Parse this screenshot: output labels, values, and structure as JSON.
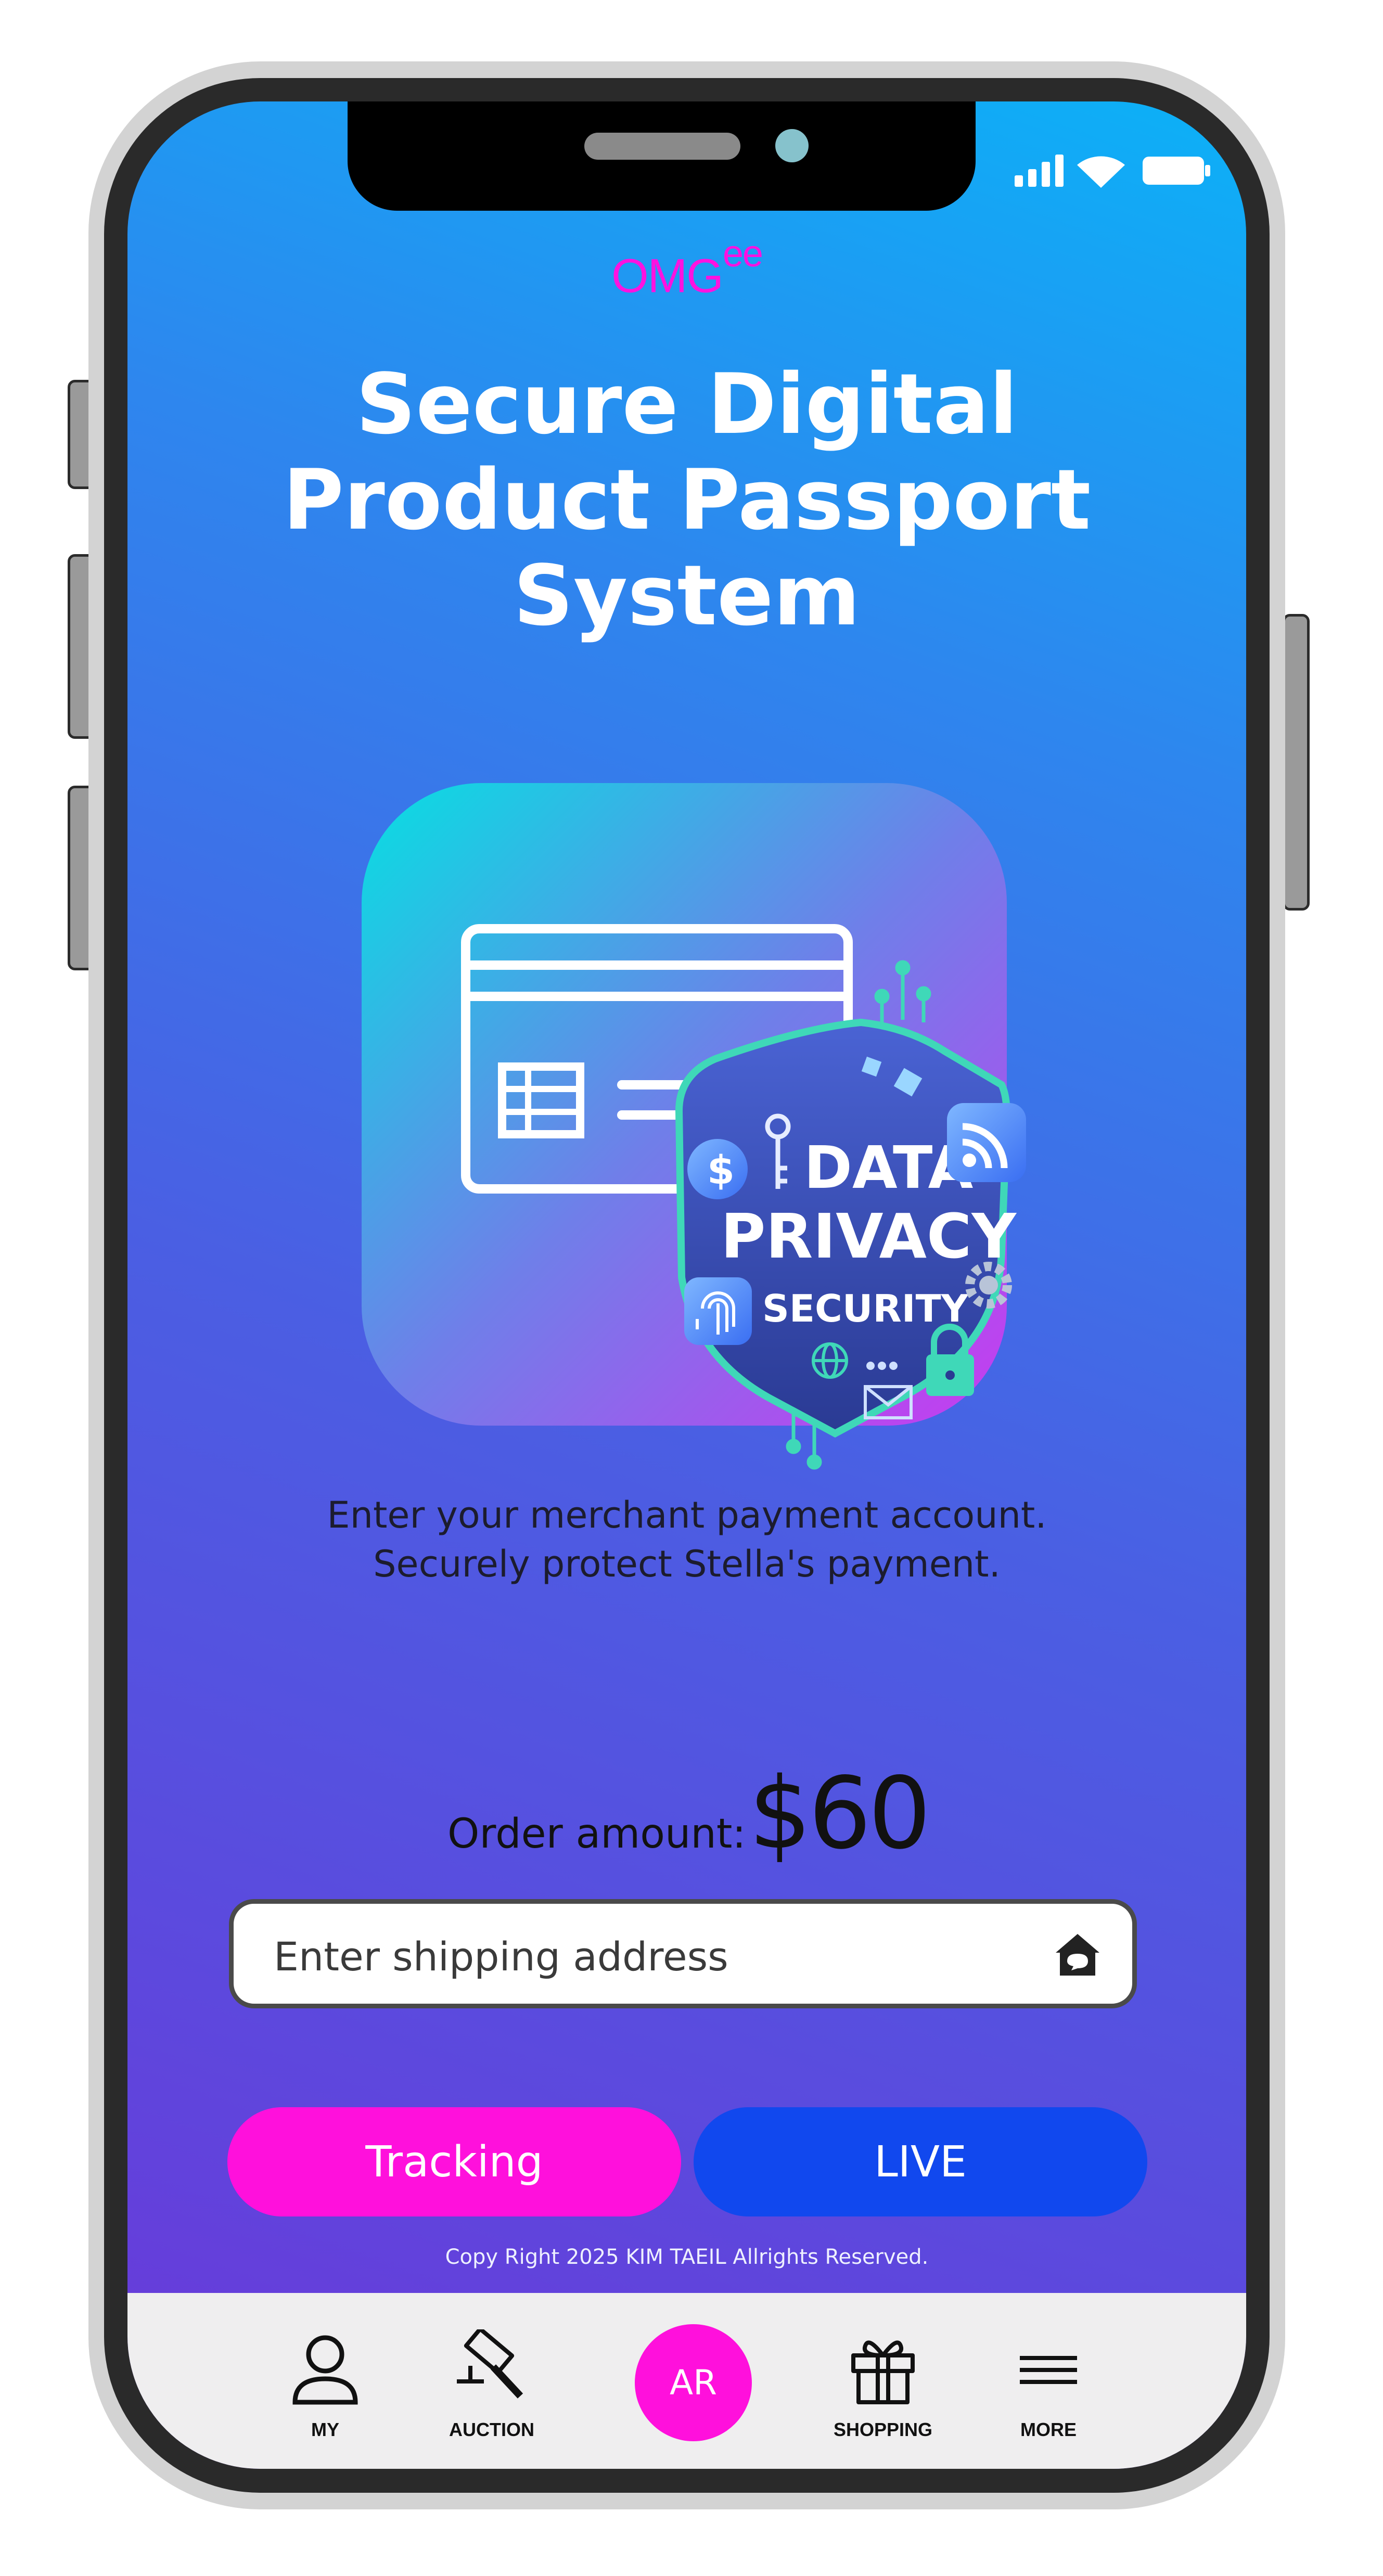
{
  "brand": {
    "logo_main": "OMG",
    "logo_suffix": "ee"
  },
  "headline": {
    "line1": "Secure Digital",
    "line2": "Product Passport",
    "line3": "System"
  },
  "illustration": {
    "badge_line1": "DATA",
    "badge_line2": "PRIVACY",
    "badge_line3": "SECURITY",
    "coin_symbol": "$"
  },
  "description": {
    "line1": "Enter your merchant payment account.",
    "line2": "Securely protect Stella's payment."
  },
  "order": {
    "label": "Order amount:",
    "amount": "$60"
  },
  "address": {
    "placeholder": "Enter shipping address",
    "value": ""
  },
  "actions": {
    "tracking_label": "Tracking",
    "live_label": "LIVE"
  },
  "footer": {
    "copyright": "Copy Right 2025 KIM TAEIL Allrights Reserved."
  },
  "nav": {
    "my": "MY",
    "auction": "AUCTION",
    "ar": "AR",
    "shopping": "SHOPPING",
    "more": "MORE"
  },
  "colors": {
    "accent_magenta": "#ff10dc",
    "accent_blue": "#1148ee",
    "gradient_top": "#0cb1f7",
    "gradient_bottom": "#6a38d9"
  }
}
